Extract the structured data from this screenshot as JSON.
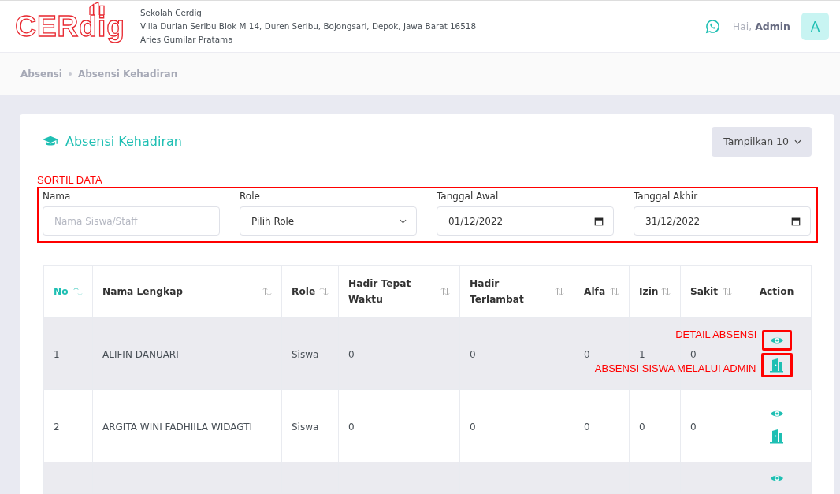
{
  "header": {
    "logo": "CERdig",
    "school_name": "Sekolah Cerdig",
    "address": "Villa Durian Seribu Blok M 14, Duren Seribu, Bojongsari, Depok, Jawa Barat 16518",
    "principal": "Aries Gumilar Pratama",
    "greeting": "Hai,",
    "user": "Admin",
    "avatar": "A"
  },
  "breadcrumb": [
    {
      "label": "Absensi"
    },
    {
      "label": "Absensi Kehadiran"
    }
  ],
  "card": {
    "title": "Absensi Kehadiran",
    "page_size_button": "Tampilkan 10"
  },
  "filter": {
    "annotation": "SORTIL DATA",
    "fields": [
      {
        "label": "Nama",
        "kind": "text",
        "placeholder": "Nama Siswa/Staff"
      },
      {
        "label": "Role",
        "kind": "select",
        "value": "Pilih Role"
      },
      {
        "label": "Tanggal Awal",
        "kind": "date",
        "value": "01/12/2022"
      },
      {
        "label": "Tanggal Akhir",
        "kind": "date",
        "value": "31/12/2022"
      }
    ]
  },
  "table": {
    "columns": [
      {
        "label": "No",
        "sortable": true,
        "sorted": true
      },
      {
        "label": "Nama Lengkap",
        "sortable": true,
        "sorted": false
      },
      {
        "label": "Role",
        "sortable": true,
        "sorted": false
      },
      {
        "label": "Hadir Tepat Waktu",
        "sortable": true,
        "sorted": false
      },
      {
        "label": "Hadir Terlambat",
        "sortable": true,
        "sorted": false
      },
      {
        "label": "Alfa",
        "sortable": true,
        "sorted": false
      },
      {
        "label": "Izin",
        "sortable": true,
        "sorted": false
      },
      {
        "label": "Sakit",
        "sortable": true,
        "sorted": false
      },
      {
        "label": "Action",
        "sortable": false,
        "sorted": false
      }
    ],
    "rows": [
      {
        "cells": [
          "1",
          "ALIFIN DANUARI",
          "Siswa",
          "0",
          "0",
          "0",
          "1",
          "0"
        ],
        "actions": [
          {
            "kind": "view",
            "highlighted": true,
            "note": "DETAIL ABSENSI"
          },
          {
            "kind": "checkin",
            "highlighted": true,
            "note": "ABSENSI SISWA MELALUI ADMIN"
          }
        ]
      },
      {
        "cells": [
          "2",
          "ARGITA WINI FADHIILA WIDAGTI",
          "Siswa",
          "0",
          "0",
          "0",
          "0",
          "0"
        ],
        "actions": [
          {
            "kind": "view",
            "highlighted": false
          },
          {
            "kind": "checkin",
            "highlighted": false
          }
        ]
      },
      {
        "actions": [
          {
            "kind": "view",
            "highlighted": false
          }
        ]
      }
    ]
  }
}
